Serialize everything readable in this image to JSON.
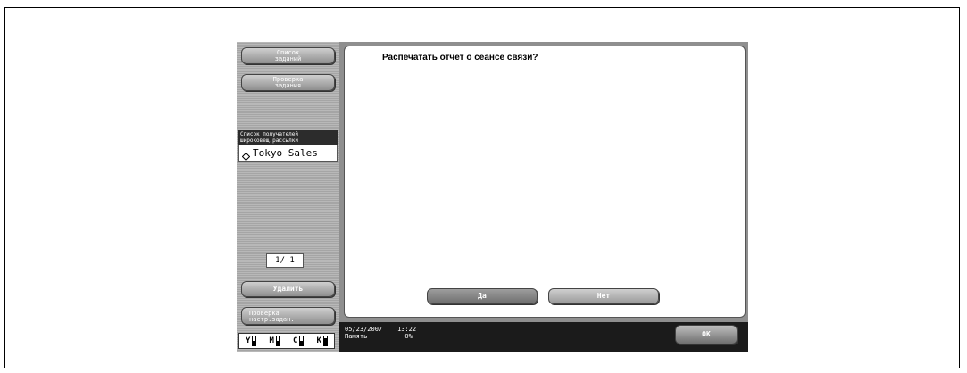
{
  "sidebar": {
    "job_list_label_1": "Список",
    "job_list_label_2": "заданий",
    "job_check_label_1": "Проверка",
    "job_check_label_2": "задания",
    "recipient_header_1": "Список получателей",
    "recipient_header_2": "широковещ.рассылки",
    "recipient_item": "Tokyo Sales",
    "recipient_icon": "diamond-icon",
    "page_indicator": "1/  1",
    "delete_label": "Удалить",
    "check_settings_label_1": "Проверка",
    "check_settings_label_2": "настр.задан.",
    "toner": [
      {
        "label": "Y",
        "level": 0.55
      },
      {
        "label": "M",
        "level": 0.55
      },
      {
        "label": "C",
        "level": 0.55
      },
      {
        "label": "K",
        "level": 0.85
      }
    ]
  },
  "dialog": {
    "question": "Распечатать отчет о сеансе связи?",
    "yes_label": "Да",
    "no_label": "Нет"
  },
  "status_bar": {
    "datetime": "05/23/2007    13:22",
    "memory": "Память          0%",
    "ok_label": "OK"
  }
}
